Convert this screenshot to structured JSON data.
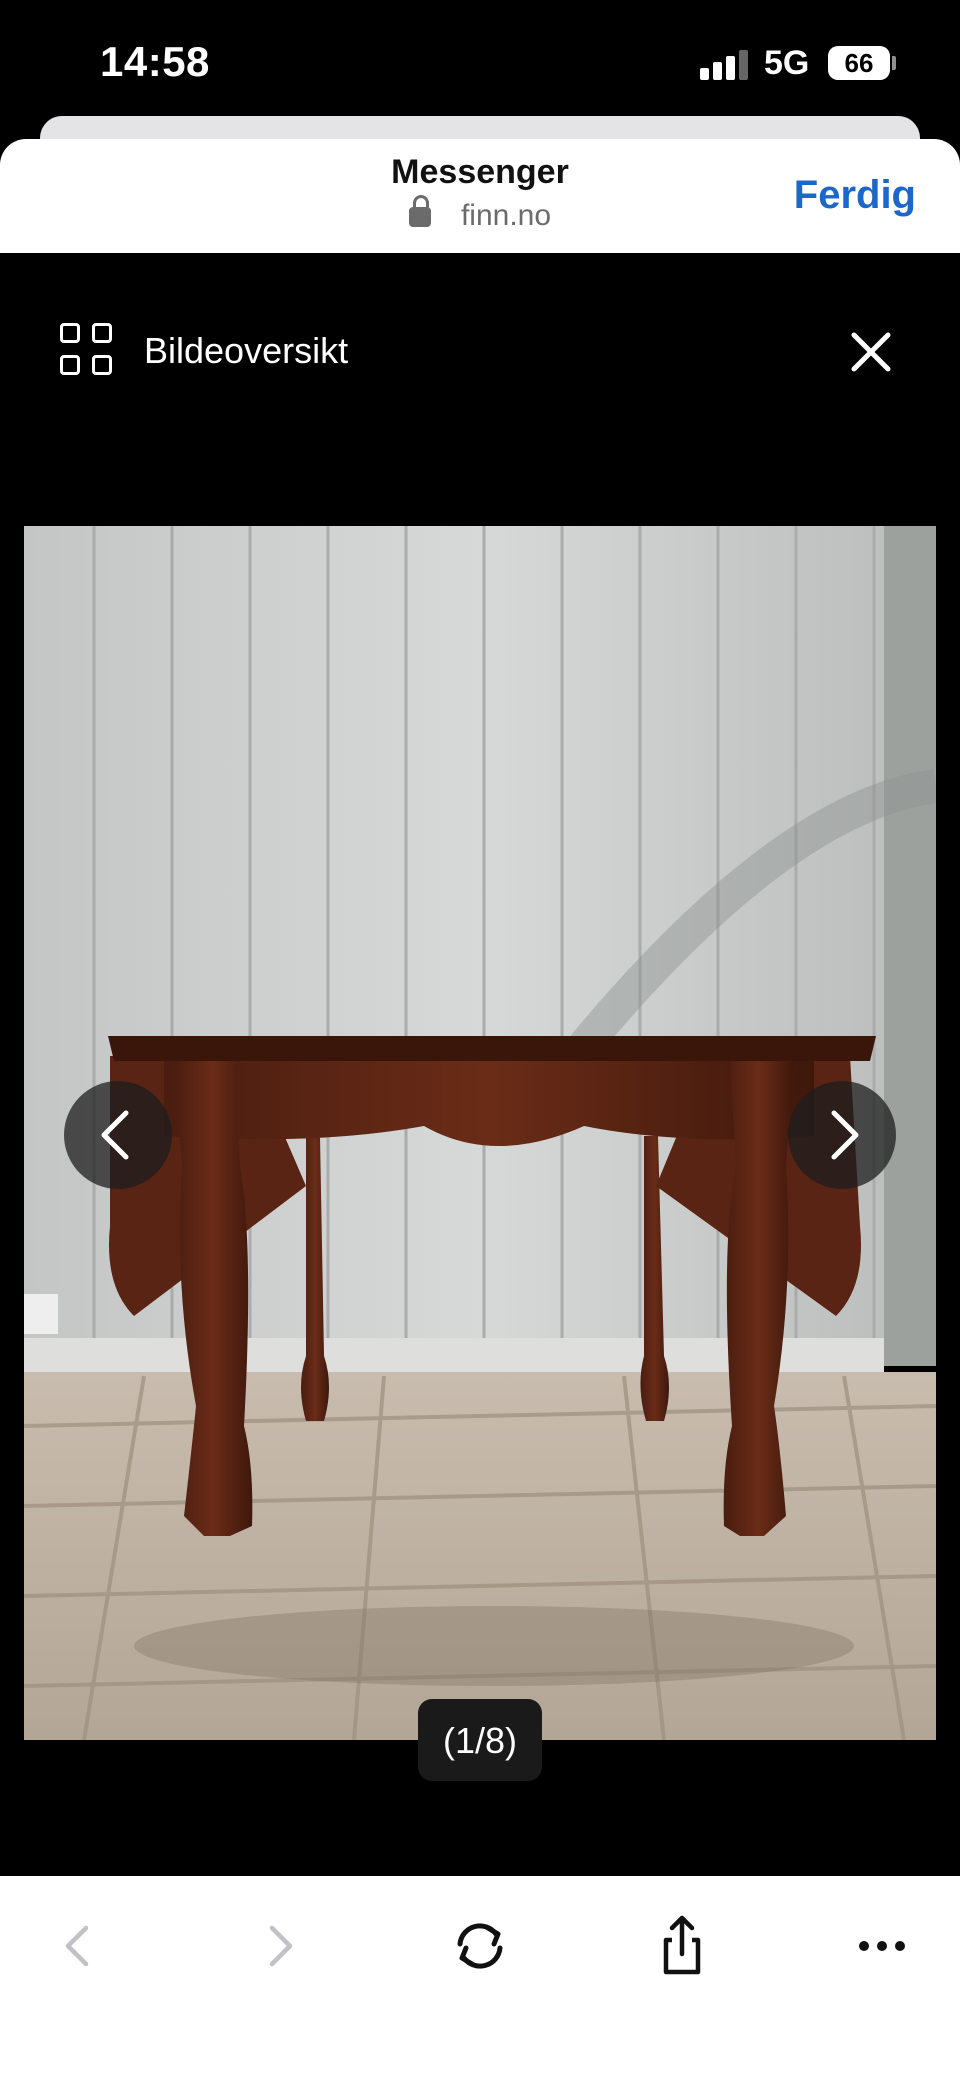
{
  "status_bar": {
    "time": "14:58",
    "network": "5G",
    "battery": "66"
  },
  "browser": {
    "title": "Messenger",
    "url": "finn.no",
    "done_label": "Ferdig",
    "accent_color": "#1d67c9"
  },
  "viewer": {
    "overview_label": "Bildeoversikt",
    "counter": "(1/8)",
    "photo_subject": "antique wooden drop-leaf table"
  },
  "icons": [
    "lock-icon",
    "grid-icon",
    "close-icon",
    "chevron-left-icon",
    "chevron-right-icon",
    "back-icon",
    "forward-icon",
    "reload-icon",
    "share-icon",
    "more-icon"
  ]
}
